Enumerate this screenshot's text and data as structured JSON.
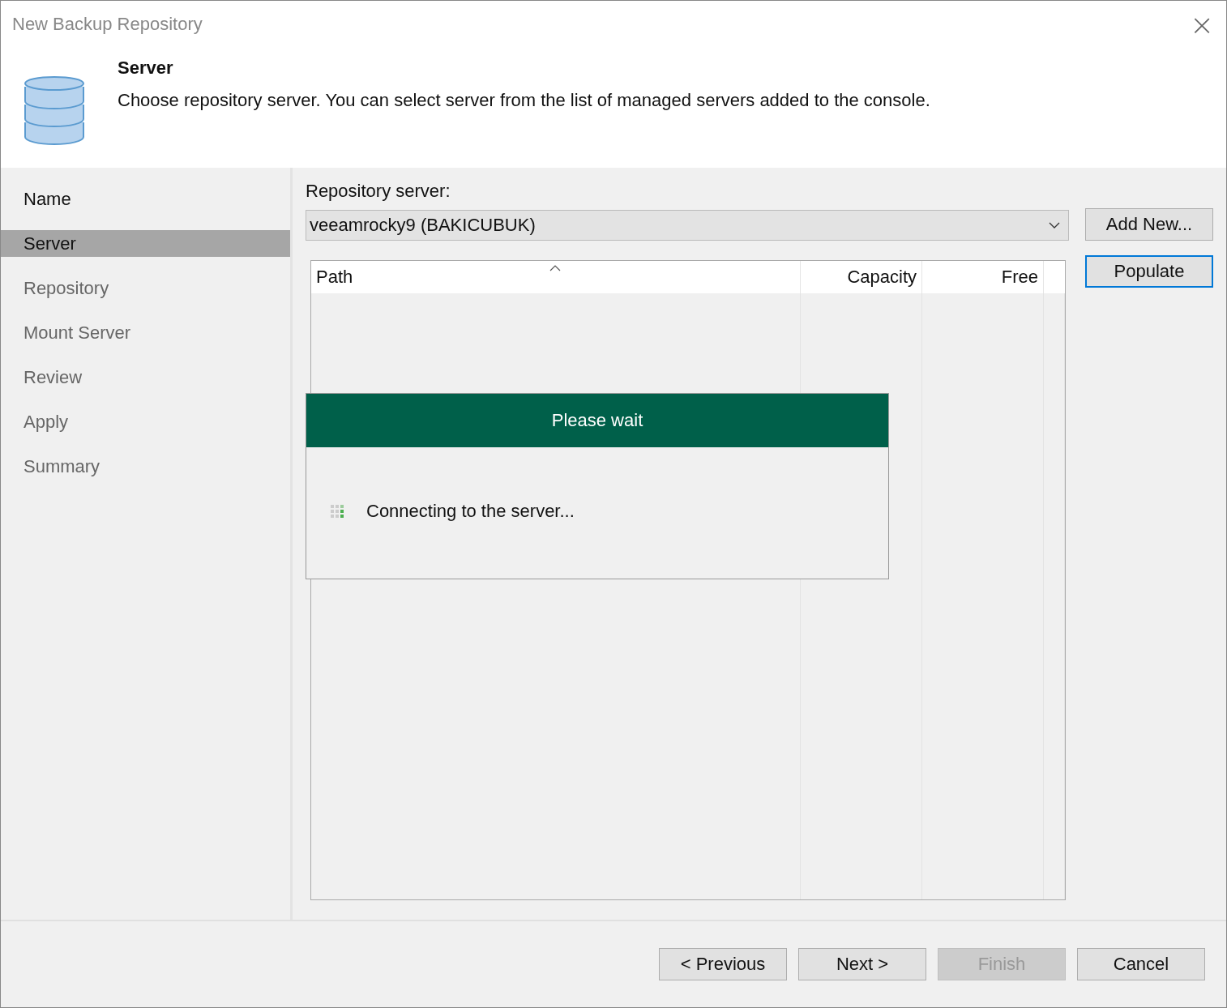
{
  "window": {
    "title": "New Backup Repository",
    "close": "×"
  },
  "header": {
    "title": "Server",
    "description": "Choose repository server. You can select server from the list of managed servers added to the console."
  },
  "steps": [
    {
      "label": "Name",
      "selected": false,
      "disabled": false
    },
    {
      "label": "Server",
      "selected": true,
      "disabled": false
    },
    {
      "label": "Repository",
      "selected": false,
      "disabled": true
    },
    {
      "label": "Mount Server",
      "selected": false,
      "disabled": true
    },
    {
      "label": "Review",
      "selected": false,
      "disabled": true
    },
    {
      "label": "Apply",
      "selected": false,
      "disabled": true
    },
    {
      "label": "Summary",
      "selected": false,
      "disabled": true
    }
  ],
  "server_label": "Repository server:",
  "server_select": {
    "value": "veeamrocky9 (BAKICUBUK)"
  },
  "side_buttons": [
    {
      "label": "Add New...",
      "focused": false
    },
    {
      "label": "Populate",
      "focused": true
    }
  ],
  "table": {
    "columns": [
      "Path",
      "Capacity",
      "Free"
    ]
  },
  "wait_dialog": {
    "title": "Please wait",
    "message": "Connecting to the server..."
  },
  "footer_buttons": [
    {
      "label": "< Previous",
      "disabled": false
    },
    {
      "label": "Next >",
      "disabled": false
    },
    {
      "label": "Finish",
      "disabled": true
    },
    {
      "label": "Cancel",
      "disabled": false
    }
  ]
}
